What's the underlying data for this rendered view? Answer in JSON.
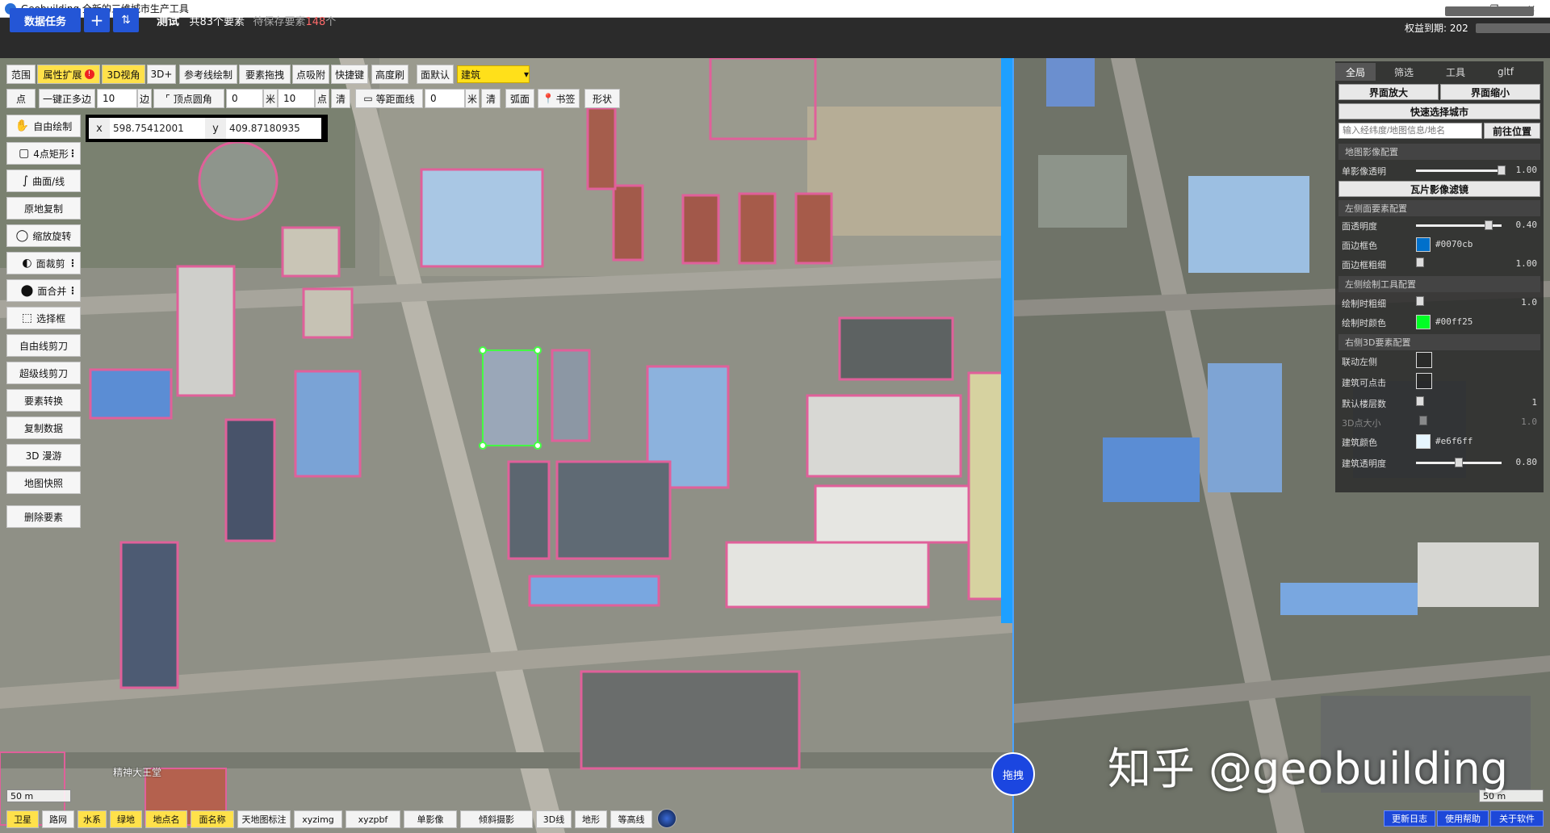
{
  "window": {
    "title": "Geobuilding 全新的三维城市生产工具",
    "minimize": "–",
    "maximize": "❐",
    "close": "✕"
  },
  "header": {
    "task_button": "数据任务",
    "add_button": "+",
    "sort_button": "⇅",
    "task_name": "测试",
    "element_count": "共83个要素",
    "pending_label": "待保存要素",
    "pending_count": "148",
    "pending_suffix": "个",
    "expire_label": "权益到期: 202"
  },
  "toolbar1": {
    "range": "范围",
    "attr_ext": "属性扩展",
    "attr_ext_badge": "!",
    "view3d": "3D视角",
    "plus3d": "3D+",
    "ref_line": "参考线绘制",
    "drag_elem": "要素拖拽",
    "point_snap": "点吸附",
    "hotkey": "快捷键",
    "height_brush": "高度刷",
    "face_default": "面默认",
    "category": "建筑"
  },
  "toolbar2": {
    "point": "点",
    "regular_poly": "一键正多边",
    "sides_value": "10",
    "sides_unit": "边",
    "vertex_round": "顶点圆角",
    "round_value": "0",
    "round_unit": "米",
    "radius_value": "10",
    "point_unit": "点",
    "clear1": "清",
    "equidistant": "等距面线",
    "equi_value": "0",
    "meter": "米",
    "clear2": "清",
    "arc": "弧面",
    "bookmark": "书签",
    "shape": "形状"
  },
  "coords": {
    "x_label": "x",
    "x_value": "598.75412001",
    "y_label": "y",
    "y_value": "409.87180935"
  },
  "left_tools": [
    {
      "icon": "✋",
      "label": "自由绘制",
      "more": ""
    },
    {
      "icon": "▢",
      "label": "4点矩形",
      "more": "⋮"
    },
    {
      "icon": "∫",
      "label": "曲面/线",
      "more": ""
    },
    {
      "icon": "",
      "label": "原地复制",
      "more": ""
    },
    {
      "icon": "◯",
      "label": "缩放旋转",
      "more": ""
    },
    {
      "icon": "◐",
      "label": "面裁剪",
      "more": "⋮"
    },
    {
      "icon": "⬤",
      "label": "面合并",
      "more": "⋮"
    },
    {
      "icon": "⬚",
      "label": "选择框",
      "more": ""
    },
    {
      "icon": "",
      "label": "自由线剪刀",
      "more": ""
    },
    {
      "icon": "",
      "label": "超级线剪刀",
      "more": ""
    },
    {
      "icon": "",
      "label": "要素转换",
      "more": ""
    },
    {
      "icon": "",
      "label": "复制数据",
      "more": ""
    },
    {
      "icon": "",
      "label": "3D 漫游",
      "more": ""
    },
    {
      "icon": "",
      "label": "地图快照",
      "more": ""
    },
    {
      "icon": "",
      "label": "删除要素",
      "more": ""
    }
  ],
  "bottom_bar": {
    "satellite": "卫星",
    "road": "路网",
    "water": "水系",
    "green": "绿地",
    "poi": "地点名",
    "area_name": "面名称",
    "tdt_label": "天地图标注",
    "xyzimg": "xyzimg",
    "xyzpbf": "xyzpbf",
    "single_img": "单影像",
    "oblique": "倾斜摄影",
    "line3d": "3D线",
    "terrain": "地形",
    "contour": "等高线",
    "scale_left": "50 m",
    "scale_right": "50 m",
    "map_label": "精神大王堂"
  },
  "drag_button": "拖拽",
  "watermark": "知乎 @geobuilding",
  "right_bottom": {
    "changelog": "更新日志",
    "help": "使用帮助",
    "about": "关于软件"
  },
  "panel": {
    "tabs": [
      "全局",
      "筛选",
      "工具",
      "gltf"
    ],
    "zoom_in": "界面放大",
    "zoom_out": "界面缩小",
    "quick_city": "快速选择城市",
    "search_placeholder": "输入经纬度/地图信息/地名",
    "goto": "前往位置",
    "sec_image": "地图影像配置",
    "single_opacity_label": "单影像透明",
    "single_opacity": "1.00",
    "single_opacity_level": 1.0,
    "tile_filter": "瓦片影像滤镜",
    "sec_left_face": "左侧面要素配置",
    "face_opacity_label": "面透明度",
    "face_opacity": "0.40",
    "face_opacity_level": 0.85,
    "edge_color_label": "面边框色",
    "edge_color": "#0070cb",
    "edge_width_label": "面边框粗细",
    "edge_width": "1.00",
    "sec_left_draw": "左侧绘制工具配置",
    "draw_width_label": "绘制时粗细",
    "draw_width": "1.0",
    "draw_color_label": "绘制时颜色",
    "draw_color": "#00ff25",
    "sec_right_3d": "右侧3D要素配置",
    "link_left_label": "联动左侧",
    "building_click_label": "建筑可点击",
    "default_floor_label": "默认楼层数",
    "default_floor": "1",
    "point3d_label": "3D点大小",
    "point3d": "1.0",
    "building_color_label": "建筑颜色",
    "building_color": "#e6f6ff",
    "building_opacity_label": "建筑透明度",
    "building_opacity": "0.80",
    "building_opacity_level": 0.5
  }
}
